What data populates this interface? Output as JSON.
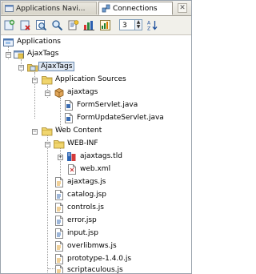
{
  "tabs": [
    {
      "label": "Applications Navi...",
      "active": false,
      "icon": "applications-navigator-icon"
    },
    {
      "label": "Connections",
      "active": true,
      "icon": "connections-icon"
    }
  ],
  "toolbar": {
    "buttons": [
      "new-icon",
      "delete-icon",
      "search-icon",
      "find-icon",
      "properties-icon",
      "chart-icon",
      "bar-chart-icon"
    ],
    "number_value": "3",
    "sort_icon": "sort-az-icon"
  },
  "tree": {
    "root": "Applications",
    "app": "AjaxTags",
    "project": "AjaxTags",
    "application_sources": "Application Sources",
    "package": "ajaxtags",
    "java_files": [
      "FormServlet.java",
      "FormUpdateServlet.java"
    ],
    "web_content": "Web Content",
    "web_inf": "WEB-INF",
    "web_inf_files": [
      "ajaxtags.tld",
      "web.xml"
    ],
    "web_files": [
      "ajaxtags.js",
      "catalog.jsp",
      "controls.js",
      "error.jsp",
      "input.jsp",
      "overlibmws.js",
      "prototype-1.4.0.js",
      "scriptaculous.js"
    ]
  },
  "colors": {
    "selection_bg": "#dfe8f4",
    "selection_border": "#6d8bb0",
    "folder": "#e9c85a"
  }
}
